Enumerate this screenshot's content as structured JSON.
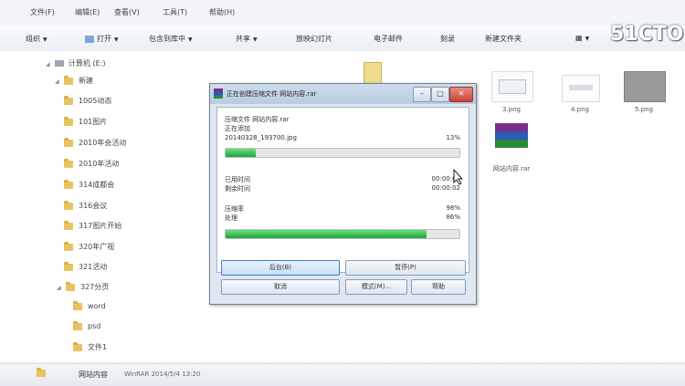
{
  "menubar": {
    "items": [
      "文件(F)",
      "编辑(E)",
      "查看(V)",
      "工具(T)",
      "帮助(H)"
    ]
  },
  "toolbar": {
    "organize": "组织",
    "open": "打开",
    "include_in_library": "包含到库中",
    "share": "共享",
    "slideshow": "放映幻灯片",
    "email": "电子邮件",
    "burn": "刻录",
    "new_folder": "新建文件夹"
  },
  "watermark": "51CTO",
  "tree": {
    "computer": "计算机  (E:)",
    "root_folder": "新建",
    "folders": [
      "1005动态",
      "101图片",
      "2010年会活动",
      "2010年活动",
      "314成都会",
      "316会议",
      "317图片开始",
      "320年广视",
      "321活动",
      "327分页"
    ],
    "sub_folders": [
      "word",
      "psd",
      "文件1"
    ]
  },
  "files": [
    {
      "label": "3.png",
      "icon": "image-icon"
    },
    {
      "label": "4.png",
      "icon": "image-icon"
    },
    {
      "label": "5.png",
      "icon": "image-icon"
    },
    {
      "label": "网站内容.rar",
      "icon": "rar-archive-icon"
    }
  ],
  "statusbar": {
    "name": "网站内容",
    "detail": "WinRAR 2014/5/4 13:20"
  },
  "dialog": {
    "title": "正在创建压缩文件 网站内容.rar",
    "line1": "压缩文件 网站内容.rar",
    "line2": "正在添加",
    "current_file": "20140328_193700.jpg",
    "current_pct": "13%",
    "elapsed_label": "已用时间",
    "elapsed_value": "00:00:01",
    "remaining_label": "剩余时间",
    "remaining_value": "00:00:02",
    "ratio_label": "压缩率",
    "ratio_value": "98%",
    "processed_label": "处理",
    "processed_value": "86%",
    "current_progress": 0.13,
    "total_progress": 0.86,
    "btn_background": "后台(B)",
    "btn_pause": "暂停(P)",
    "btn_cancel": "取消",
    "btn_mode": "模式(M)...",
    "btn_help": "帮助"
  }
}
